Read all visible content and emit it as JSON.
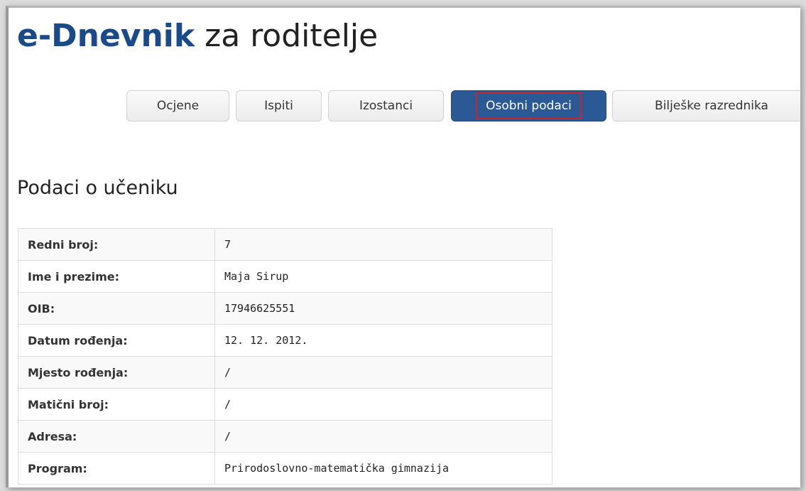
{
  "header": {
    "brand": "e-Dnevnik",
    "subtitle": " za roditelje"
  },
  "tabs": [
    {
      "label": "Ocjene",
      "active": false
    },
    {
      "label": "Ispiti",
      "active": false
    },
    {
      "label": "Izostanci",
      "active": false
    },
    {
      "label": "Osobni podaci",
      "active": true
    },
    {
      "label": "Bilješke razrednika",
      "active": false
    }
  ],
  "section": {
    "title": "Podaci o učeniku"
  },
  "student_info": [
    {
      "label": "Redni broj:",
      "value": "7"
    },
    {
      "label": "Ime i prezime:",
      "value": "Maja Sirup"
    },
    {
      "label": "OIB:",
      "value": "17946625551"
    },
    {
      "label": "Datum rođenja:",
      "value": "12. 12. 2012."
    },
    {
      "label": "Mjesto rođenja:",
      "value": "/"
    },
    {
      "label": "Matični broj:",
      "value": "/"
    },
    {
      "label": "Adresa:",
      "value": "/"
    },
    {
      "label": "Program:",
      "value": "Prirodoslovno-matematička gimnazija"
    }
  ],
  "colors": {
    "brand": "#1a4a87",
    "active_tab": "#2b5996",
    "highlight_outline": "#c8252c"
  }
}
